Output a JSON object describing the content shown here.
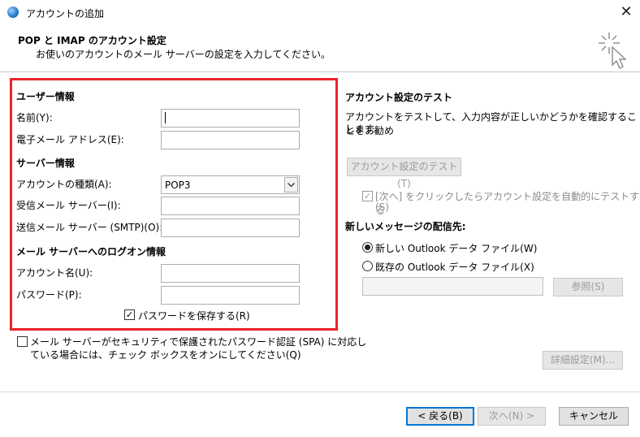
{
  "window": {
    "title": "アカウントの追加",
    "close_label": "✕"
  },
  "header": {
    "title": "POP と IMAP のアカウント設定",
    "subtitle": "お使いのアカウントのメール サーバーの設定を入力してください。"
  },
  "user_info": {
    "heading": "ユーザー情報",
    "name_label": "名前(Y):",
    "name_value": "",
    "email_label": "電子メール アドレス(E):",
    "email_value": ""
  },
  "server_info": {
    "heading": "サーバー情報",
    "account_type_label": "アカウントの種類(A):",
    "account_type_value": "POP3",
    "incoming_label": "受信メール サーバー(I):",
    "incoming_value": "",
    "outgoing_label": "送信メール サーバー (SMTP)(O):",
    "outgoing_value": ""
  },
  "logon_info": {
    "heading": "メール サーバーへのログオン情報",
    "account_name_label": "アカウント名(U):",
    "account_name_value": "",
    "password_label": "パスワード(P):",
    "password_value": "",
    "save_password_label": "パスワードを保存する(R)",
    "save_password_checked": true
  },
  "spa": {
    "label_line1": "メール サーバーがセキュリティで保護されたパスワード認証 (SPA) に対応し",
    "label_line2": "ている場合には、チェック ボックスをオンにしてください(Q)",
    "checked": false
  },
  "test": {
    "heading": "アカウント設定のテスト",
    "desc_line1": "アカウントをテストして、入力内容が正しいかどうかを確認することをお勧め",
    "desc_line2": "します。",
    "test_button": "アカウント設定のテスト(T)",
    "auto_test_line1": "[次へ] をクリックしたらアカウント設定を自動的にテストする",
    "auto_test_line2": "(S)",
    "auto_test_checked": true
  },
  "delivery": {
    "heading": "新しいメッセージの配信先:",
    "option_new": "新しい Outlook データ ファイル(W)",
    "option_existing": "既存の Outlook データ ファイル(X)",
    "selected": "new",
    "path_value": "",
    "browse_button": "参照(S)"
  },
  "buttons": {
    "advanced": "詳細設定(M)...",
    "back": "< 戻る(B)",
    "next": "次へ(N) >",
    "cancel": "キャンセル"
  },
  "colors": {
    "highlight_border": "#e8232b",
    "default_button_border": "#0078d7"
  }
}
